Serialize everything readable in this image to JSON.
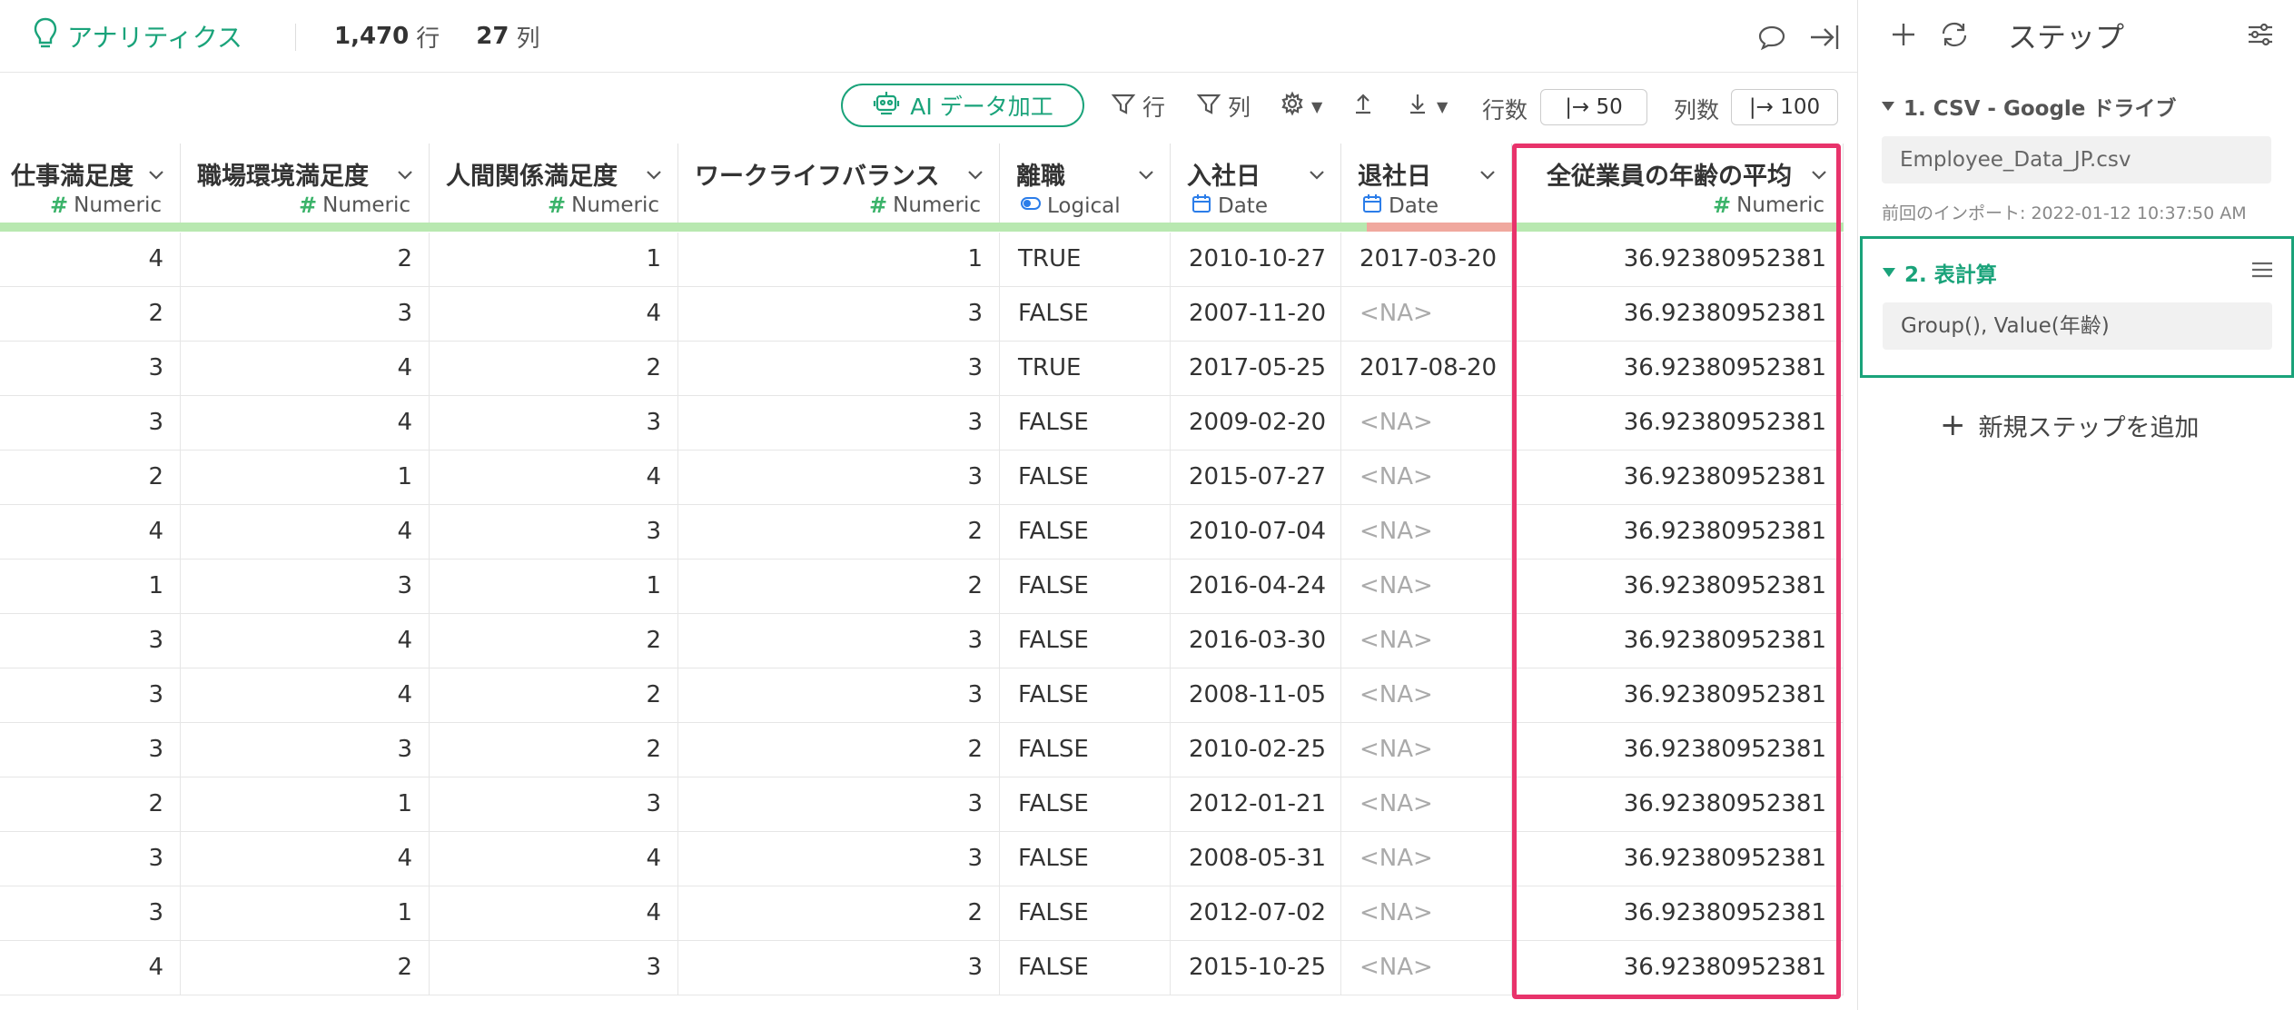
{
  "app": {
    "title": "アナリティクス",
    "rows_count": "1,470",
    "rows_unit": "行",
    "cols_count": "27",
    "cols_unit": "列",
    "accent_color": "#1aa37a",
    "highlight_color": "#e8336b"
  },
  "toolbar": {
    "ai_label": "AI データ加工",
    "filter_rows": "行",
    "filter_cols": "列",
    "rows_label": "行数",
    "rows_value": "|→ 50",
    "cols_label": "列数",
    "cols_value": "|→ 100"
  },
  "columns": [
    {
      "name": "仕事満足度",
      "type": "Numeric"
    },
    {
      "name": "職場環境満足度",
      "type": "Numeric"
    },
    {
      "name": "人間関係満足度",
      "type": "Numeric"
    },
    {
      "name": "ワークライフバランス",
      "type": "Numeric"
    },
    {
      "name": "離職",
      "type": "Logical"
    },
    {
      "name": "入社日",
      "type": "Date"
    },
    {
      "name": "退社日",
      "type": "Date"
    },
    {
      "name": "全従業員の年齢の平均",
      "type": "Numeric"
    }
  ],
  "rows": [
    [
      "4",
      "2",
      "1",
      "1",
      "TRUE",
      "2010-10-27",
      "2017-03-20",
      "36.92380952381"
    ],
    [
      "2",
      "3",
      "4",
      "3",
      "FALSE",
      "2007-11-20",
      "<NA>",
      "36.92380952381"
    ],
    [
      "3",
      "4",
      "2",
      "3",
      "TRUE",
      "2017-05-25",
      "2017-08-20",
      "36.92380952381"
    ],
    [
      "3",
      "4",
      "3",
      "3",
      "FALSE",
      "2009-02-20",
      "<NA>",
      "36.92380952381"
    ],
    [
      "2",
      "1",
      "4",
      "3",
      "FALSE",
      "2015-07-27",
      "<NA>",
      "36.92380952381"
    ],
    [
      "4",
      "4",
      "3",
      "2",
      "FALSE",
      "2010-07-04",
      "<NA>",
      "36.92380952381"
    ],
    [
      "1",
      "3",
      "1",
      "2",
      "FALSE",
      "2016-04-24",
      "<NA>",
      "36.92380952381"
    ],
    [
      "3",
      "4",
      "2",
      "3",
      "FALSE",
      "2016-03-30",
      "<NA>",
      "36.92380952381"
    ],
    [
      "3",
      "4",
      "2",
      "3",
      "FALSE",
      "2008-11-05",
      "<NA>",
      "36.92380952381"
    ],
    [
      "3",
      "3",
      "2",
      "2",
      "FALSE",
      "2010-02-25",
      "<NA>",
      "36.92380952381"
    ],
    [
      "2",
      "1",
      "3",
      "3",
      "FALSE",
      "2012-01-21",
      "<NA>",
      "36.92380952381"
    ],
    [
      "3",
      "4",
      "4",
      "3",
      "FALSE",
      "2008-05-31",
      "<NA>",
      "36.92380952381"
    ],
    [
      "3",
      "1",
      "4",
      "2",
      "FALSE",
      "2012-07-02",
      "<NA>",
      "36.92380952381"
    ],
    [
      "4",
      "2",
      "3",
      "3",
      "FALSE",
      "2015-10-25",
      "<NA>",
      "36.92380952381"
    ]
  ],
  "panel": {
    "title": "ステップ",
    "step1_title": "1. CSV - Google ドライブ",
    "step1_file": "Employee_Data_JP.csv",
    "step1_meta": "前回のインポート: 2022-01-12 10:37:50 AM",
    "step2_title": "2. 表計算",
    "step2_expr": "Group(), Value(年齢)",
    "add_step": "新規ステップを追加"
  }
}
